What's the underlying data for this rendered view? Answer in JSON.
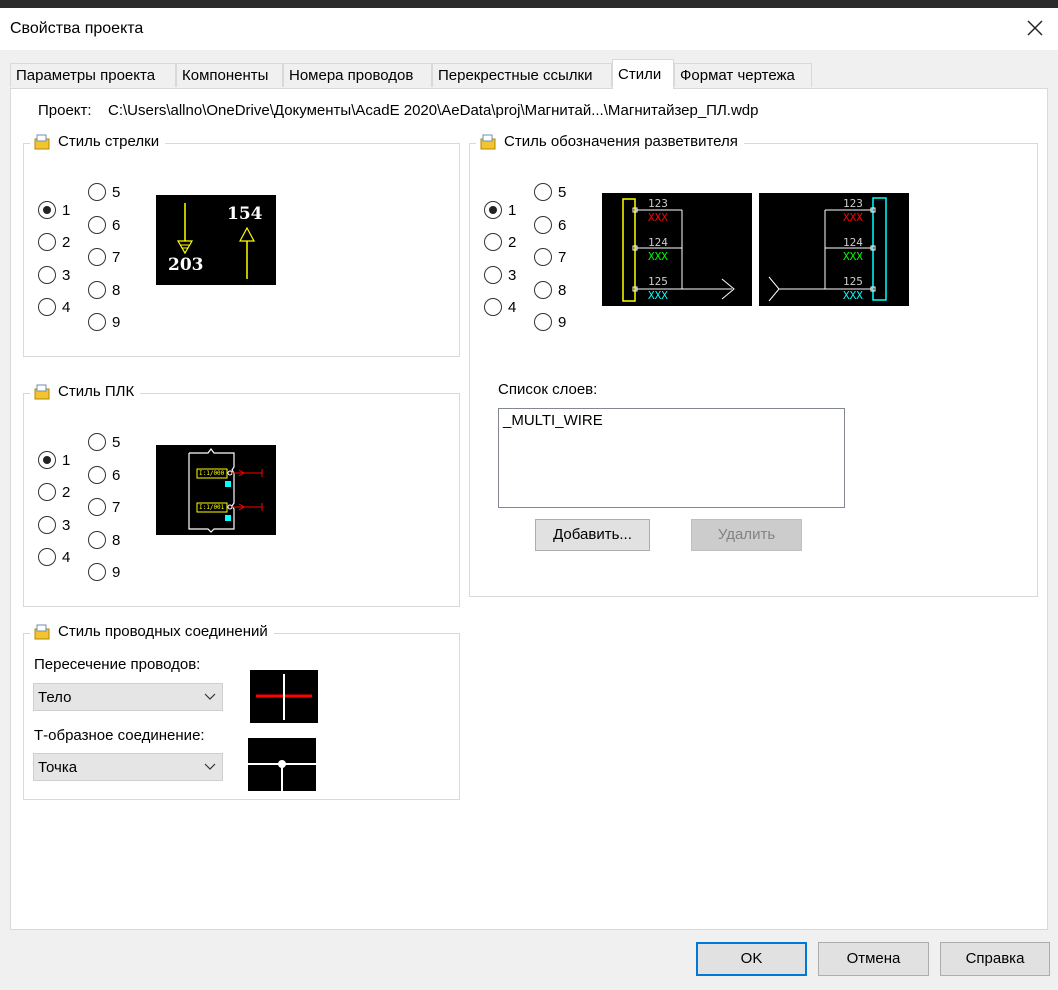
{
  "window": {
    "title": "Свойства проекта"
  },
  "tabs": [
    "Параметры проекта",
    "Компоненты",
    "Номера проводов",
    "Перекрестные ссылки",
    "Стили",
    "Формат чертежа"
  ],
  "active_tab": "Стили",
  "project": {
    "label": "Проект:",
    "path": "C:\\Users\\allno\\OneDrive\\Документы\\AcadE 2020\\AeData\\proj\\Магнитай...\\Магнитайзер_ПЛ.wdp"
  },
  "arrow_style": {
    "title": "Стиль стрелки",
    "options": [
      "1",
      "2",
      "3",
      "4",
      "5",
      "6",
      "7",
      "8",
      "9"
    ],
    "selected": "1",
    "preview": {
      "label_left": "203",
      "label_right": "154"
    }
  },
  "plc_style": {
    "title": "Стиль ПЛК",
    "options": [
      "1",
      "2",
      "3",
      "4",
      "5",
      "6",
      "7",
      "8",
      "9"
    ],
    "selected": "1",
    "preview": {
      "cell1": "I:1/000",
      "cell2": "I:1/001"
    }
  },
  "wire_connection_style": {
    "title": "Стиль проводных соединений",
    "crossing_label": "Пересечение проводов:",
    "crossing_value": "Тело",
    "tee_label": "Т-образное соединение:",
    "tee_value": "Точка"
  },
  "fanout_style": {
    "title": "Стиль обозначения разветвителя",
    "options": [
      "1",
      "2",
      "3",
      "4",
      "5",
      "6",
      "7",
      "8",
      "9"
    ],
    "selected": "1",
    "preview": {
      "numbers": [
        "123",
        "124",
        "125"
      ],
      "markers": [
        "XXX",
        "XXX",
        "XXX"
      ]
    },
    "layer_list_label": "Список слоев:",
    "layers": [
      "_MULTI_WIRE"
    ],
    "add_button": "Добавить...",
    "delete_button": "Удалить"
  },
  "footer": {
    "ok": "OK",
    "cancel": "Отмена",
    "help": "Справка"
  },
  "colors": {
    "accent": "#0078d7",
    "preview_bg": "#000000",
    "yellow": "#ffff00",
    "red": "#ff0000",
    "green": "#00ff00",
    "cyan": "#00ffff"
  }
}
